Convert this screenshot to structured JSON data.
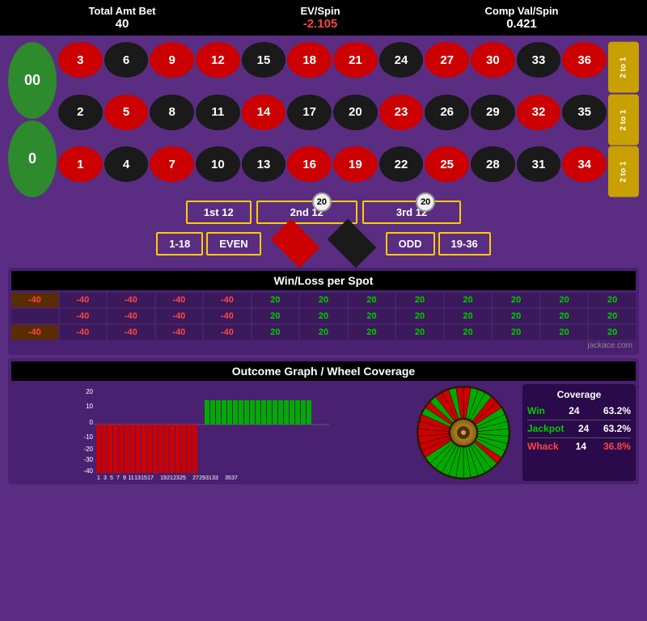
{
  "stats": {
    "total_label": "Total Amt Bet",
    "total_value": "40",
    "ev_label": "EV/Spin",
    "ev_value": "-2.105",
    "comp_label": "Comp Val/Spin",
    "comp_value": "0.421"
  },
  "roulette": {
    "zeros": [
      "00",
      "0"
    ],
    "grid": [
      {
        "n": "3",
        "c": "red"
      },
      {
        "n": "6",
        "c": "black"
      },
      {
        "n": "9",
        "c": "red"
      },
      {
        "n": "12",
        "c": "red"
      },
      {
        "n": "15",
        "c": "black"
      },
      {
        "n": "18",
        "c": "red"
      },
      {
        "n": "21",
        "c": "red"
      },
      {
        "n": "24",
        "c": "black"
      },
      {
        "n": "27",
        "c": "red"
      },
      {
        "n": "30",
        "c": "red"
      },
      {
        "n": "33",
        "c": "black"
      },
      {
        "n": "36",
        "c": "red"
      },
      {
        "n": "2",
        "c": "black"
      },
      {
        "n": "5",
        "c": "red"
      },
      {
        "n": "8",
        "c": "black"
      },
      {
        "n": "11",
        "c": "black"
      },
      {
        "n": "14",
        "c": "red"
      },
      {
        "n": "17",
        "c": "black"
      },
      {
        "n": "20",
        "c": "black"
      },
      {
        "n": "23",
        "c": "red"
      },
      {
        "n": "26",
        "c": "black"
      },
      {
        "n": "29",
        "c": "black"
      },
      {
        "n": "32",
        "c": "red"
      },
      {
        "n": "35",
        "c": "black"
      },
      {
        "n": "1",
        "c": "red"
      },
      {
        "n": "4",
        "c": "black"
      },
      {
        "n": "7",
        "c": "red"
      },
      {
        "n": "10",
        "c": "black"
      },
      {
        "n": "13",
        "c": "black"
      },
      {
        "n": "16",
        "c": "red"
      },
      {
        "n": "19",
        "c": "red"
      },
      {
        "n": "22",
        "c": "black"
      },
      {
        "n": "25",
        "c": "red"
      },
      {
        "n": "28",
        "c": "black"
      },
      {
        "n": "31",
        "c": "black"
      },
      {
        "n": "34",
        "c": "red"
      }
    ],
    "side_bets": [
      "2 to 1",
      "2 to 1",
      "2 to 1"
    ],
    "dozens": [
      "1st 12",
      "2nd 12",
      "3rd 12"
    ],
    "dozen_chips": [
      "",
      "20",
      "20"
    ],
    "bottom_bets": [
      "1-18",
      "EVEN",
      "ODD",
      "19-36"
    ]
  },
  "wl_table": {
    "title": "Win/Loss per Spot",
    "rows": [
      [
        "-40",
        "-40",
        "-40",
        "-40",
        "-40",
        "20",
        "20",
        "20",
        "20",
        "20",
        "20",
        "20",
        "20"
      ],
      [
        "",
        "-40",
        "-40",
        "-40",
        "-40",
        "20",
        "20",
        "20",
        "20",
        "20",
        "20",
        "20",
        "20"
      ],
      [
        "-40",
        "-40",
        "-40",
        "-40",
        "-40",
        "20",
        "20",
        "20",
        "20",
        "20",
        "20",
        "20",
        "20"
      ]
    ],
    "highlighted": [
      [
        0,
        0
      ],
      [
        2,
        0
      ]
    ],
    "jackace": "jackace.com"
  },
  "outcome": {
    "title": "Outcome Graph / Wheel Coverage",
    "bars": {
      "negative": [
        1,
        2,
        3,
        4,
        5,
        6,
        7,
        8,
        9,
        10,
        11,
        12,
        13,
        14,
        15,
        16,
        17,
        18
      ],
      "positive": [
        19,
        20,
        21,
        22,
        23,
        24,
        25,
        26,
        27,
        28,
        29,
        30,
        31,
        32,
        33,
        34,
        35,
        36,
        37
      ],
      "neg_height": -40,
      "pos_height": 20,
      "y_labels": [
        "20",
        "10",
        "0",
        "-10",
        "-20",
        "-30",
        "-40"
      ],
      "x_labels": [
        "1",
        "3",
        "5",
        "7",
        "9",
        "11",
        "13",
        "15",
        "17",
        "19",
        "21",
        "23",
        "25",
        "27",
        "29",
        "31",
        "33",
        "35",
        "37"
      ]
    },
    "coverage": {
      "title": "Coverage",
      "win_label": "Win",
      "win_count": "24",
      "win_pct": "63.2%",
      "jackpot_label": "Jackpot",
      "jackpot_count": "24",
      "jackpot_pct": "63.2%",
      "whack_label": "Whack",
      "whack_count": "14",
      "whack_pct": "36.8%"
    }
  }
}
